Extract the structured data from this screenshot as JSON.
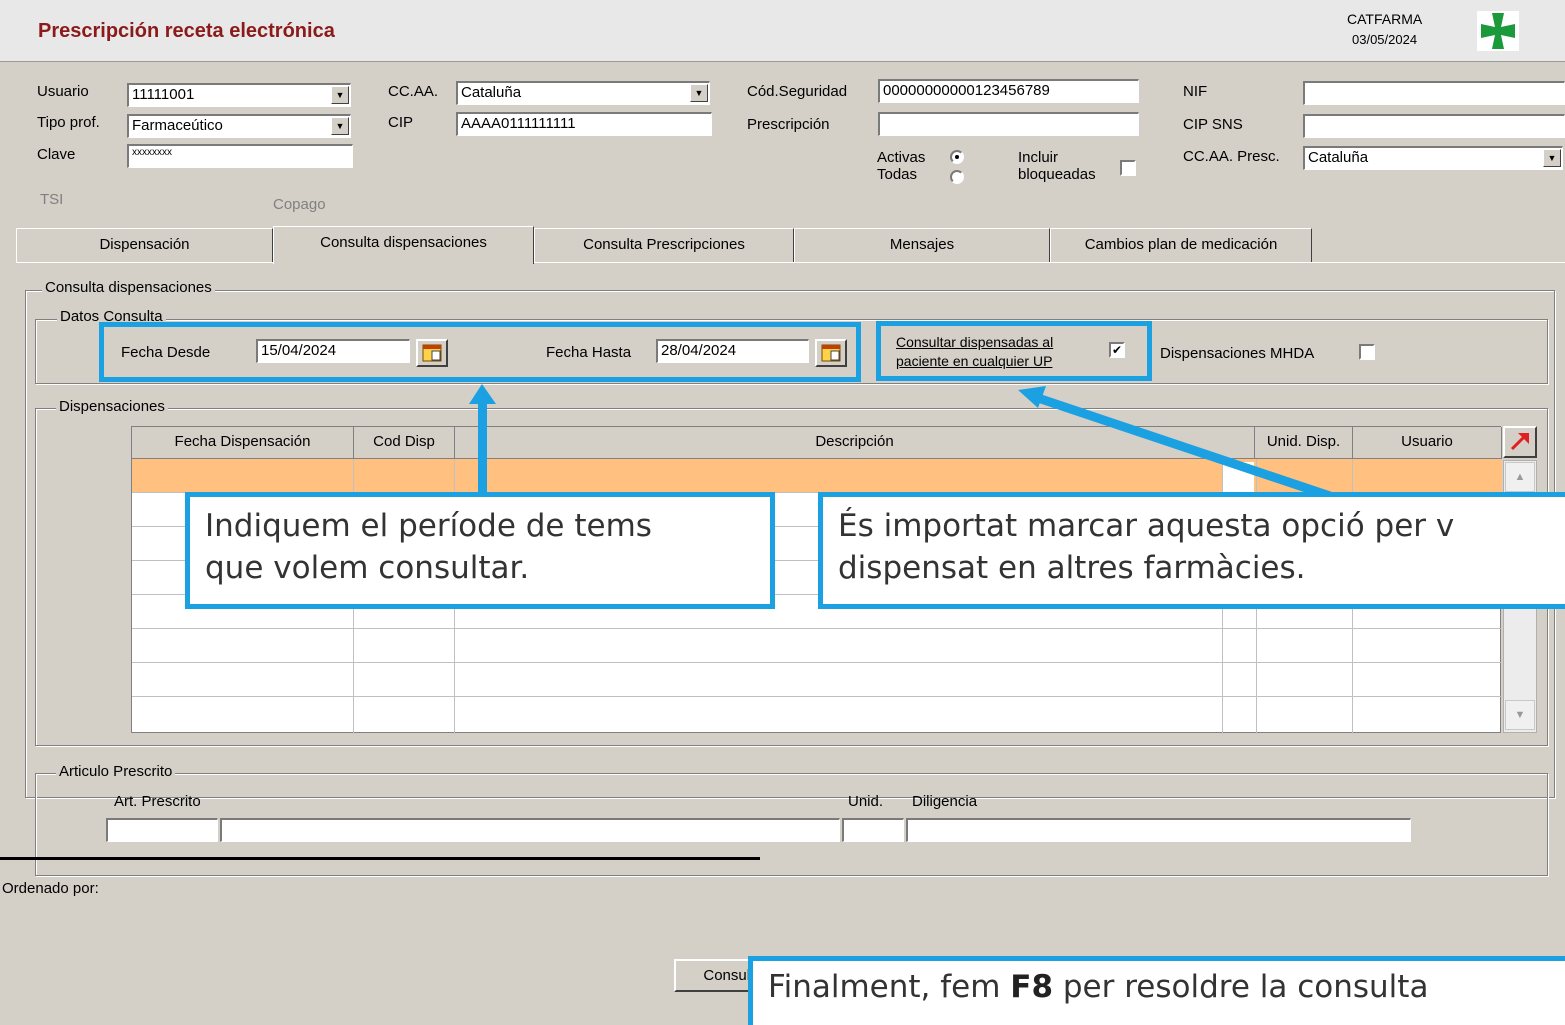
{
  "window": {
    "title": "Prescripción receta electrónica",
    "org": "CATFARMA",
    "date": "03/05/2024",
    "logo_icon": "green-cross-logo-icon"
  },
  "header": {
    "usuario_label": "Usuario",
    "usuario_value": "11111001",
    "tipo_prof_label": "Tipo prof.",
    "tipo_prof_value": "Farmaceútico",
    "clave_label": "Clave",
    "clave_value": "xxxxxxxx",
    "ccaa_label": "CC.AA.",
    "ccaa_value": "Cataluña",
    "cip_label": "CIP",
    "cip_value": "AAAA0111111111",
    "cod_seg_label": "Cód.Seguridad",
    "cod_seg_value": "00000000000123456789",
    "prescripcion_label": "Prescripción",
    "prescripcion_value": "",
    "activas_label": "Activas",
    "todas_label": "Todas",
    "incluir_label": "Incluir",
    "bloqueadas_label": "bloqueadas",
    "nif_label": "NIF",
    "nif_value": "",
    "cip_sns_label": "CIP SNS",
    "cip_sns_value": "",
    "ccaa_presc_label": "CC.AA. Presc.",
    "ccaa_presc_value": "Cataluña",
    "tsi_label": "TSI",
    "copago_label": "Copago"
  },
  "tabs": [
    {
      "label": "Dispensación"
    },
    {
      "label": "Consulta dispensaciones",
      "active": true
    },
    {
      "label": "Consulta Prescripciones"
    },
    {
      "label": "Mensajes"
    },
    {
      "label": "Cambios plan de medicación"
    }
  ],
  "consulta": {
    "group_title": "Consulta dispensaciones",
    "datos_title": "Datos Consulta",
    "fecha_desde_label": "Fecha Desde",
    "fecha_desde_value": "15/04/2024",
    "fecha_hasta_label": "Fecha Hasta",
    "fecha_hasta_value": "28/04/2024",
    "calendar_icon": "calendar-icon",
    "consultar_line1": "Consultar dispensadas al",
    "consultar_line2": "paciente en cualquier UP",
    "consultar_checked": true,
    "mhda_label": "Dispensaciones MHDA",
    "mhda_checked": false
  },
  "dispensaciones": {
    "group_title": "Dispensaciones",
    "columns": [
      "Fecha Dispensación",
      "Cod Disp",
      "Descripción",
      "Unid. Disp.",
      "Usuario"
    ],
    "rows": 8
  },
  "articulo": {
    "group_title": "Articulo Prescrito",
    "art_label": "Art. Prescrito",
    "unid_label": "Unid.",
    "diligencia_label": "Diligencia"
  },
  "footer": {
    "ordenado_label": "Ordenado por:",
    "consultar_button": "Consultar tarifación"
  },
  "callouts": {
    "periode": "Indiquem el període de tems\nque volem consultar.",
    "opcio_line1": "És importat marcar aquesta opció per v",
    "opcio_line2": "dispensat en altres farmàcies.",
    "final_pre": "Finalment, fem ",
    "final_key": "F8",
    "final_post": " per resoldre la consulta"
  },
  "colors": {
    "accent": "#1ba1e2",
    "title_red": "#8b1a1a",
    "selected_row": "#ffc080"
  }
}
